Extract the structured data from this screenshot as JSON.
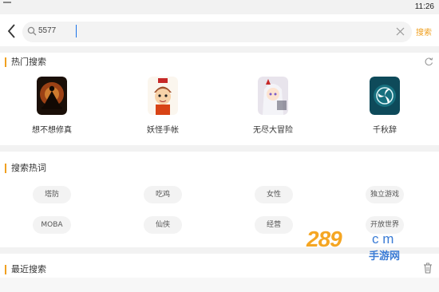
{
  "status_bar": {
    "time": "11:26"
  },
  "search": {
    "query": "5577",
    "search_label": "搜索",
    "back_icon": "chevron-left-icon",
    "search_icon": "search-icon",
    "clear_icon": "close-icon"
  },
  "hot_search": {
    "title": "热门搜索",
    "refresh_icon": "refresh-icon",
    "apps": [
      {
        "name": "想不想修真",
        "icon": "app-icon-meditating-figure"
      },
      {
        "name": "妖怪手帐",
        "icon": "app-icon-cartoon-boy"
      },
      {
        "name": "无尽大冒险",
        "icon": "app-icon-anime-girl"
      },
      {
        "name": "千秋辞",
        "icon": "app-icon-triskelion-emblem"
      }
    ]
  },
  "hot_words": {
    "title": "搜索热词",
    "tags": [
      "塔防",
      "吃鸡",
      "女性",
      "独立游戏",
      "MOBA",
      "仙侠",
      "经营",
      "开放世界"
    ]
  },
  "recent_search": {
    "title": "最近搜索",
    "delete_icon": "trash-icon"
  },
  "watermark": {
    "logo_text": "289",
    "domain": "c m",
    "sub": "手游网"
  },
  "colors": {
    "accent": "#f0a020",
    "background": "#ffffff",
    "divider": "#f2f2f2",
    "tag_bg": "#f3f3f3"
  }
}
